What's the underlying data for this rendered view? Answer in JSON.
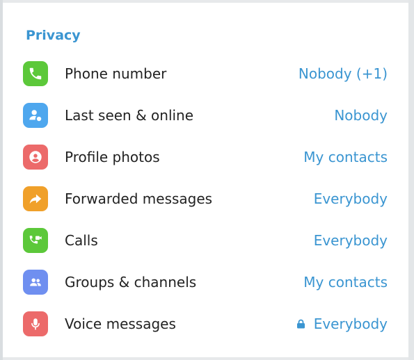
{
  "section": {
    "title": "Privacy"
  },
  "items": [
    {
      "label": "Phone number",
      "value": "Nobody (+1)",
      "icon": "phone-icon",
      "color": "#5cc83a",
      "locked": false
    },
    {
      "label": "Last seen & online",
      "value": "Nobody",
      "icon": "user-clock-icon",
      "color": "#4ea7ee",
      "locked": false
    },
    {
      "label": "Profile photos",
      "value": "My contacts",
      "icon": "profile-photo-icon",
      "color": "#ec6a6a",
      "locked": false
    },
    {
      "label": "Forwarded messages",
      "value": "Everybody",
      "icon": "forward-icon",
      "color": "#f0a02a",
      "locked": false
    },
    {
      "label": "Calls",
      "value": "Everybody",
      "icon": "video-call-icon",
      "color": "#5cc83a",
      "locked": false
    },
    {
      "label": "Groups & channels",
      "value": "My contacts",
      "icon": "group-icon",
      "color": "#6f8ff0",
      "locked": false
    },
    {
      "label": "Voice messages",
      "value": "Everybody",
      "icon": "microphone-icon",
      "color": "#ec6a6a",
      "locked": true
    }
  ]
}
